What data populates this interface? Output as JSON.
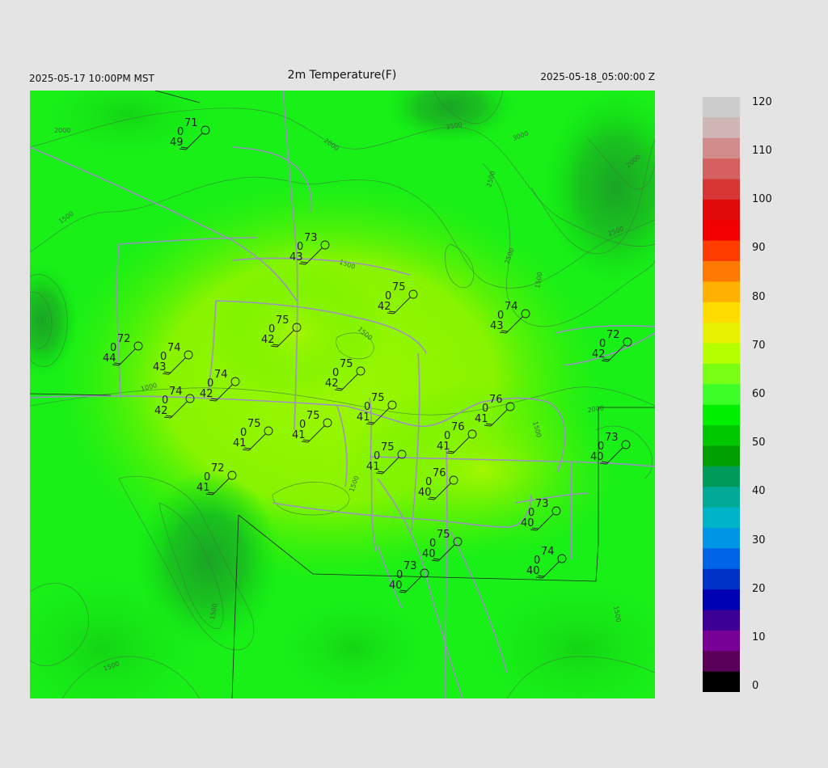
{
  "header": {
    "title": "2m Temperature(F)",
    "local_time": "2025-05-17 10:00PM MST",
    "utc_time": "2025-05-18_05:00:00 Z"
  },
  "colorbar": {
    "ticks": [
      "120",
      "110",
      "100",
      "90",
      "80",
      "70",
      "60",
      "50",
      "40",
      "30",
      "20",
      "10",
      "0"
    ],
    "colors": [
      "#cccccc",
      "#d0b5b5",
      "#d38c8c",
      "#d56060",
      "#d83535",
      "#e00a0a",
      "#f20000",
      "#ff3c00",
      "#ff7a00",
      "#ffb000",
      "#ffdc00",
      "#e6f000",
      "#b4ff00",
      "#78ff14",
      "#3cff28",
      "#00f000",
      "#00c800",
      "#00a000",
      "#009b5a",
      "#00aa96",
      "#00b4c8",
      "#0096e6",
      "#0064e6",
      "#0032c8",
      "#0000b4",
      "#3c0096",
      "#780096",
      "#5a005a",
      "#000000"
    ]
  },
  "contour_labels": [
    "2000",
    "2000",
    "2500",
    "3000",
    "3500",
    "1500",
    "2500",
    "2500",
    "2000",
    "1500",
    "1500",
    "1500",
    "1500",
    "2000",
    "1500",
    "1000",
    "1500",
    "1500",
    "1500"
  ],
  "stations": [
    {
      "temp": "71",
      "dew": "49",
      "wind": "0"
    },
    {
      "temp": "73",
      "dew": "43",
      "wind": "0"
    },
    {
      "temp": "75",
      "dew": "42",
      "wind": "0"
    },
    {
      "temp": "74",
      "dew": "43",
      "wind": "0"
    },
    {
      "temp": "75",
      "dew": "42",
      "wind": "0"
    },
    {
      "temp": "72",
      "dew": "44",
      "wind": "0"
    },
    {
      "temp": "74",
      "dew": "43",
      "wind": "0"
    },
    {
      "temp": "74",
      "dew": "42",
      "wind": "0"
    },
    {
      "temp": "75",
      "dew": "42",
      "wind": "0"
    },
    {
      "temp": "72",
      "dew": "42",
      "wind": "0"
    },
    {
      "temp": "74",
      "dew": "42",
      "wind": "0"
    },
    {
      "temp": "75",
      "dew": "41",
      "wind": "0"
    },
    {
      "temp": "76",
      "dew": "41",
      "wind": "0"
    },
    {
      "temp": "75",
      "dew": "41",
      "wind": "0"
    },
    {
      "temp": "75",
      "dew": "41",
      "wind": "0"
    },
    {
      "temp": "76",
      "dew": "41",
      "wind": "0"
    },
    {
      "temp": "73",
      "dew": "40",
      "wind": "0"
    },
    {
      "temp": "72",
      "dew": "41",
      "wind": "0"
    },
    {
      "temp": "75",
      "dew": "41",
      "wind": "0"
    },
    {
      "temp": "76",
      "dew": "40",
      "wind": "0"
    },
    {
      "temp": "73",
      "dew": "40",
      "wind": "0"
    },
    {
      "temp": "75",
      "dew": "40",
      "wind": "0"
    },
    {
      "temp": "74",
      "dew": "40",
      "wind": "0"
    },
    {
      "temp": "73",
      "dew": "40",
      "wind": "0"
    }
  ]
}
